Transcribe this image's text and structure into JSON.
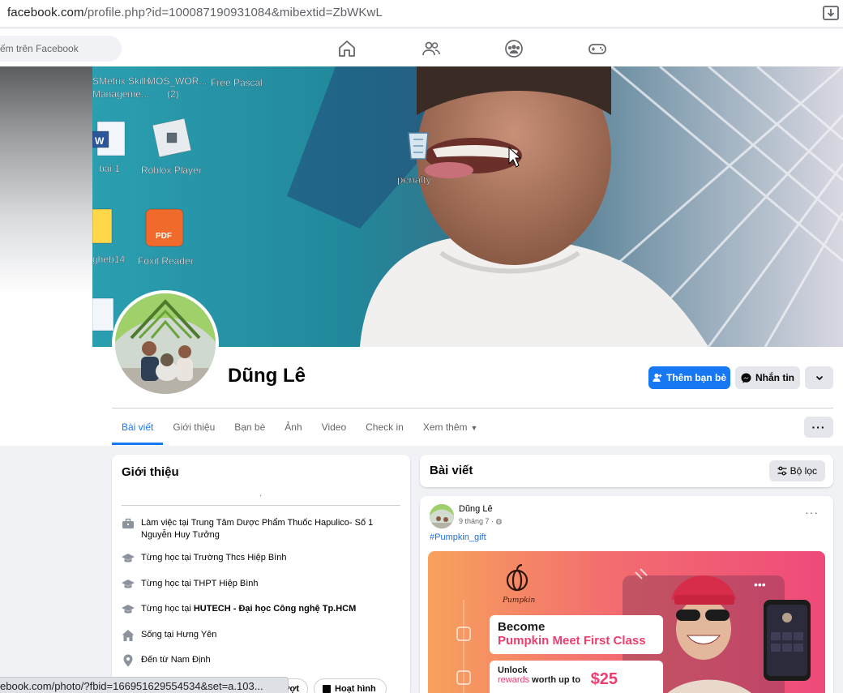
{
  "browser": {
    "url_host": "facebook.com",
    "url_path": "/profile.php?id=100087190931084&mibextid=ZbWKwL",
    "status_url": "ebook.com/photo/?fbid=166951629554534&set=a.103..."
  },
  "nav": {
    "search_placeholder": "ếm trên Facebook"
  },
  "cover": {
    "desktop_icons": [
      "SMetrix Skills Manageme...",
      "MOS_WOR... (2)",
      "Free Pascal",
      "bai 1",
      "Roblox Player",
      "penalty",
      "gheb14",
      "Foxit Reader"
    ]
  },
  "profile": {
    "name": "Dũng Lê",
    "add_friend_label": "Thêm bạn bè",
    "message_label": "Nhắn tin"
  },
  "tabs": [
    {
      "label": "Bài viết",
      "active": true
    },
    {
      "label": "Giới thiệu"
    },
    {
      "label": "Bạn bè"
    },
    {
      "label": "Ảnh"
    },
    {
      "label": "Video"
    },
    {
      "label": "Check in"
    },
    {
      "label": "Xem thêm"
    }
  ],
  "intro": {
    "title": "Giới thiệu",
    "bio": ".",
    "items": [
      {
        "icon": "briefcase-icon",
        "prefix": "Làm việc tại ",
        "bold": "",
        "text": "Trung Tâm Dược Phẩm Thuốc Hapulico- Số 1 Nguyễn Huy Tưởng"
      },
      {
        "icon": "graduation-cap-icon",
        "prefix": "Từng học tại ",
        "bold": "",
        "text": "Trường Thcs Hiệp Bình"
      },
      {
        "icon": "graduation-cap-icon",
        "prefix": "Từng học tại ",
        "bold": "",
        "text": "THPT Hiệp Bình"
      },
      {
        "icon": "graduation-cap-icon",
        "prefix": "Từng học tại ",
        "bold": "HUTECH - Đại học Công nghệ Tp.HCM",
        "text": ""
      },
      {
        "icon": "home-icon",
        "prefix": "Sống tại ",
        "bold": "",
        "text": "Hưng Yên"
      },
      {
        "icon": "location-pin-icon",
        "prefix": "Đến từ ",
        "bold": "",
        "text": "Nam Định"
      }
    ],
    "chips": [
      "ượt",
      "Hoạt hình"
    ]
  },
  "posts": {
    "title": "Bài viết",
    "filter_label": "Bộ lọc",
    "post": {
      "author": "Dũng Lê",
      "time": "9 tháng 7 ·",
      "hashtag": "#Pumpkin_gift",
      "banner": {
        "brand": "Pumpkin",
        "line1": "Become",
        "line2": "Pumpkin Meet First Class",
        "line3": "Unlock",
        "line4_pink": "rewards",
        "line4": " worth up to",
        "amount": "$25"
      }
    }
  },
  "colors": {
    "fb_blue": "#1877f2",
    "pumpkin_pink": "#ec3f6f"
  }
}
